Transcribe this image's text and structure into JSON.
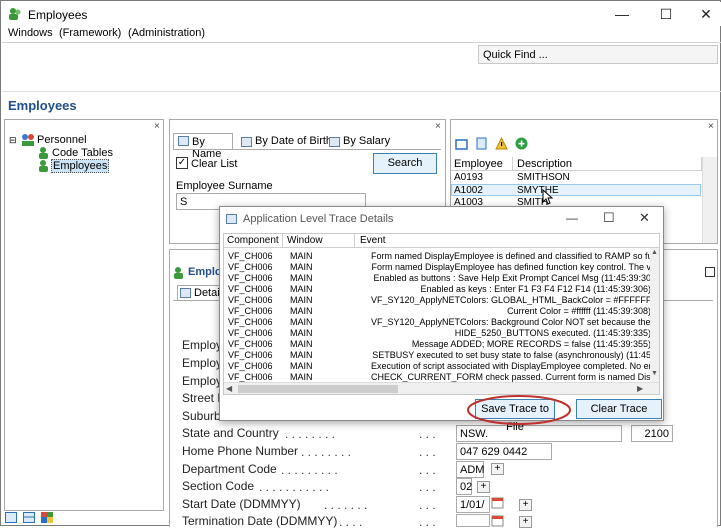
{
  "window": {
    "title": "Employees",
    "minimize": "—",
    "maximize": "☐",
    "close": "✕"
  },
  "menu": {
    "windows": "Windows",
    "framework": "(Framework)",
    "administration": "(Administration)"
  },
  "quick_find": "Quick Find ...",
  "page_title": "Employees",
  "close_glyph": "×",
  "tree": {
    "root": "Personnel",
    "child1": "Code Tables",
    "child2": "Employees"
  },
  "search_panel": {
    "tabs": [
      "By Name",
      "By Date of Birth",
      "By Salary"
    ],
    "clear_list": "Clear List",
    "search_button": "Search",
    "surname_label": "Employee Surname",
    "surname_value": "S"
  },
  "list_panel": {
    "columns": [
      "Employee",
      "Description"
    ],
    "rows": [
      {
        "id": "A0193",
        "desc": "SMITHSON"
      },
      {
        "id": "A1002",
        "desc": "SMYTHE"
      },
      {
        "id": "A1003",
        "desc": "SMITH"
      }
    ]
  },
  "detail": {
    "title": "Employ",
    "tab": "Details",
    "fields": [
      {
        "label": "Employ",
        "value": ""
      },
      {
        "label": "Employ",
        "value": ""
      },
      {
        "label": "Employ",
        "value": ""
      },
      {
        "label": "Street N",
        "value": ""
      },
      {
        "label": "Suburb",
        "value": ""
      },
      {
        "label": "State and Country",
        "dots": ". . . . . . . .",
        "dots2": ". . .",
        "value": "NSW.",
        "value2": "2100"
      },
      {
        "label": "Home Phone Number",
        "dots": ". . . . . . . .",
        "dots2": ". . .",
        "value": "047 629 0442"
      },
      {
        "label": "Department Code",
        "dots": ". . . . . . . . .",
        "dots2": ". . .",
        "value": "ADM"
      },
      {
        "label": "Section Code",
        "dots": ". . . . . . . . . . .",
        "dots2": ". . .",
        "value": "02"
      },
      {
        "label": "Start Date (DDMMYY)",
        "dots": ". . . . . . .",
        "dots2": ". . .",
        "value": "1/01/"
      },
      {
        "label": "Termination Date (DDMMYY)",
        "dots": ". . . .",
        "dots2": ". . .",
        "value": ""
      }
    ],
    "plus": "+"
  },
  "trace_dialog": {
    "title": "Application Level Trace Details",
    "columns": [
      "Component",
      "Window",
      "Event"
    ],
    "rows": [
      {
        "c": "VF_CH006",
        "w": "MAIN",
        "e": "Form named DisplayEmployee is defined and classified to RAMP so fur"
      },
      {
        "c": "VF_CH006",
        "w": "MAIN",
        "e": "Form named DisplayEmployee has defined function key control. The v"
      },
      {
        "c": "VF_CH006",
        "w": "MAIN",
        "e": "Enabled as buttons : Save Help Exit Prompt Cancel Msg (11:45:39:30"
      },
      {
        "c": "VF_CH006",
        "w": "MAIN",
        "e": "Enabled as keys : Enter F1 F3 F4 F12 F14 (11:45:39:306)"
      },
      {
        "c": "VF_CH006",
        "w": "MAIN",
        "e": "VF_SY120_ApplyNETColors: GLOBAL_HTML_BackColor = #FFFFFF (1"
      },
      {
        "c": "VF_CH006",
        "w": "MAIN",
        "e": "Current Color = #ffffff (11:45:39:308)"
      },
      {
        "c": "VF_CH006",
        "w": "MAIN",
        "e": "VF_SY120_ApplyNETColors: Background Color NOT set because they"
      },
      {
        "c": "VF_CH006",
        "w": "MAIN",
        "e": "HIDE_5250_BUTTONS executed. (11:45:39:335)"
      },
      {
        "c": "VF_CH006",
        "w": "MAIN",
        "e": "Message ADDED; MORE RECORDS = false (11:45:39:355)"
      },
      {
        "c": "VF_CH006",
        "w": "MAIN",
        "e": "SETBUSY executed to set busy state to false (asynchronously) (11:45"
      },
      {
        "c": "VF_CH006",
        "w": "MAIN",
        "e": "Execution of script associated with DisplayEmployee completed. No erro"
      },
      {
        "c": "VF_CH006",
        "w": "MAIN",
        "e": "CHECK_CURRENT_FORM check passed. Current form is named DisplayEmplo"
      }
    ],
    "save_button": "Save Trace to File",
    "clear_button": "Clear Trace",
    "minimize": "—",
    "maximize": "☐",
    "close": "✕"
  },
  "colors": {
    "accent": "#1f4f8c",
    "highlight": "#e5f1fb",
    "circle": "#c0302c"
  }
}
